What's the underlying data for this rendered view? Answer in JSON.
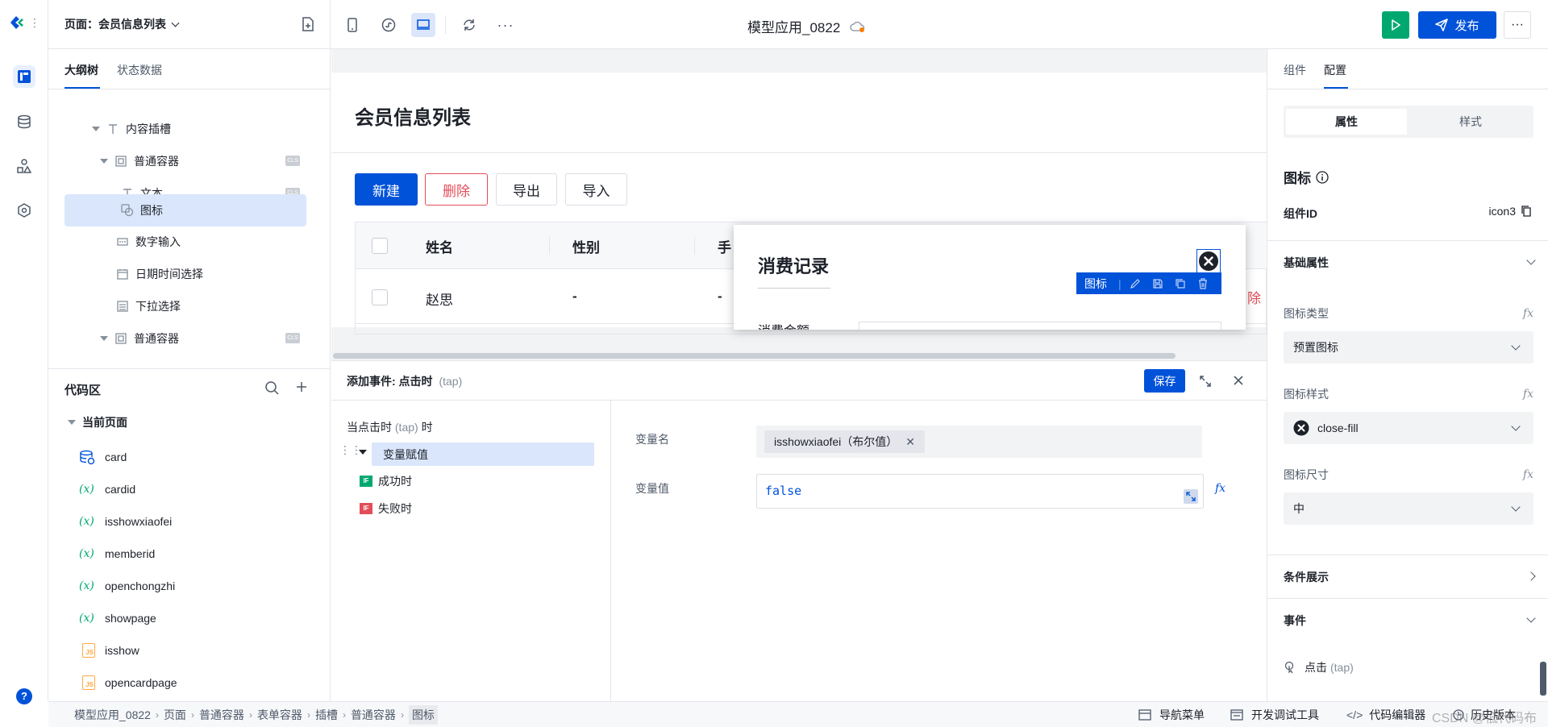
{
  "topbar": {
    "page_label": "页面：会员信息列表",
    "app_title": "模型应用_0822",
    "publish_label": "发布"
  },
  "outline": {
    "tabs": [
      "大纲树",
      "状态数据"
    ],
    "items": [
      {
        "label": "内容插槽",
        "icon": "text-icon"
      },
      {
        "label": "普通容器",
        "icon": "container-icon",
        "badge": "CLS"
      },
      {
        "label": "文本",
        "icon": "text-icon",
        "badge": "CLS"
      },
      {
        "label": "图标",
        "icon": "icon-component-icon"
      },
      {
        "label": "数字输入",
        "icon": "number-input-icon"
      },
      {
        "label": "日期时间选择",
        "icon": "calendar-icon"
      },
      {
        "label": "下拉选择",
        "icon": "select-icon"
      },
      {
        "label": "普通容器",
        "icon": "container-icon",
        "badge": "CLS"
      }
    ]
  },
  "code": {
    "title": "代码区",
    "group": "当前页面",
    "items": [
      {
        "label": "card",
        "type": "datasource"
      },
      {
        "label": "cardid",
        "type": "variable"
      },
      {
        "label": "isshowxiaofei",
        "type": "variable"
      },
      {
        "label": "memberid",
        "type": "variable"
      },
      {
        "label": "openchongzhi",
        "type": "variable"
      },
      {
        "label": "showpage",
        "type": "variable"
      },
      {
        "label": "isshow",
        "type": "js"
      },
      {
        "label": "opencardpage",
        "type": "js"
      }
    ],
    "var_symbol": "(x)",
    "js_symbol": "JS"
  },
  "canvas": {
    "page_title": "会员信息列表",
    "buttons": {
      "new": "新建",
      "delete": "删除",
      "export": "导出",
      "import": "导入"
    },
    "table": {
      "headers": [
        "姓名",
        "性别",
        "手"
      ],
      "row": [
        "赵思",
        "-",
        "-"
      ],
      "row_action": "除"
    },
    "dialog": {
      "title": "消费记录",
      "field_label": "消费金额",
      "toolbar_label": "图标"
    }
  },
  "event": {
    "title": "添加事件: 点击时",
    "title_tap": "(tap)",
    "save_label": "保存",
    "trigger_prefix": "当点击时",
    "trigger_tap": "(tap)",
    "trigger_suffix": "时",
    "action": "变量赋值",
    "success": "成功时",
    "fail": "失败时",
    "if_badge": "IF",
    "var_name_label": "变量名",
    "var_name_value": "isshowxiaofei（布尔值）",
    "var_value_label": "变量值",
    "var_value": "false"
  },
  "right": {
    "tabs": [
      "组件",
      "配置"
    ],
    "seg": [
      "属性",
      "样式"
    ],
    "icon_title": "图标",
    "component_id_label": "组件ID",
    "component_id": "icon3",
    "basic_props": "基础属性",
    "icon_type_label": "图标类型",
    "icon_type_value": "预置图标",
    "icon_style_label": "图标样式",
    "icon_style_value": "close-fill",
    "icon_size_label": "图标尺寸",
    "icon_size_value": "中",
    "condition": "条件展示",
    "events": "事件",
    "event_item": "点击",
    "event_item_tap": "(tap)",
    "fx": "fx"
  },
  "footer": {
    "breadcrumb": [
      "模型应用_0822",
      "页面",
      "普通容器",
      "表单容器",
      "插槽",
      "普通容器",
      "图标"
    ],
    "nav_menu": "导航菜单",
    "devtools": "开发调试工具",
    "code_editor": "代码编辑器",
    "history": "历史版本",
    "watermark": "CSDN @低代码布道师"
  },
  "colors": {
    "primary": "#0052d9",
    "success": "#00a870",
    "danger": "#e34d59"
  }
}
